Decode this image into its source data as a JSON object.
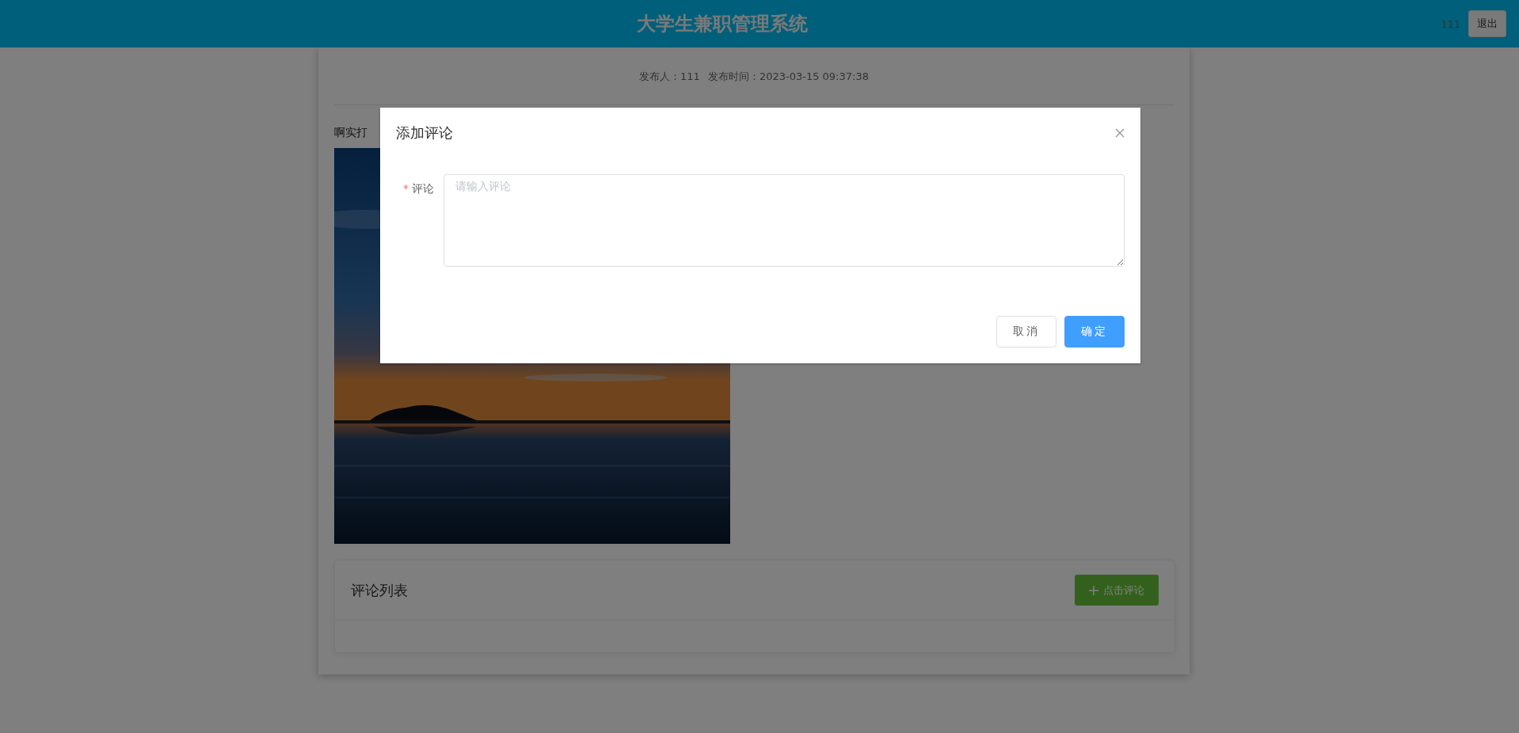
{
  "header": {
    "title": "大学生兼职管理系统",
    "username": "111",
    "logout": "退出"
  },
  "post": {
    "author": "发布人：111",
    "time": "发布时间：2023-03-15 09:37:38",
    "content": "啊实打"
  },
  "comments": {
    "title": "评论列表",
    "add_button": "点击评论"
  },
  "dialog": {
    "title": "添加评论",
    "field": {
      "label": "评论",
      "required_mark": "*",
      "placeholder": "请输入评论"
    },
    "buttons": [
      {
        "label": "取消",
        "kind": "default"
      },
      {
        "label": "确定",
        "kind": "primary"
      }
    ]
  }
}
